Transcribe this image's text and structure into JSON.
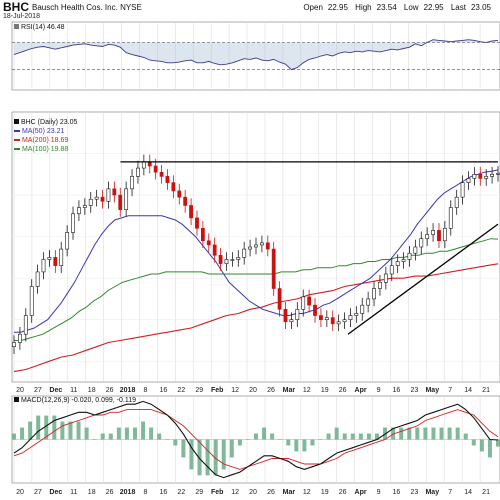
{
  "header": {
    "symbol": "BHC",
    "name": "Bausch Health Cos. Inc.",
    "exchange": "NYSE",
    "date": "18-Jul-2018",
    "open_label": "Open",
    "open": "22.95",
    "high_label": "High",
    "high": "23.54",
    "low_label": "Low",
    "low": "22.95",
    "last_label": "Last",
    "last": "23.05"
  },
  "legends": {
    "rsi": "RSI(14) 46.48",
    "price": "BHC (Daily) 23.05",
    "ma50": "MA(50) 23.21",
    "ma200": "MA(200) 18.69",
    "ma100": "MA(100) 19.88",
    "macd_main": "MACD(12,26,9)",
    "macd_vals": "-0.020, 0.099, -0.119"
  },
  "colors": {
    "ma50": "#3a36b8",
    "ma100": "#2e8a2e",
    "ma200": "#d11f1f",
    "up": "#1a1a1a",
    "down": "#cc1111",
    "trend": "#000000",
    "rsi_fill": "#9fb5cf",
    "macd_line": "#111111",
    "signal_line": "#d22222",
    "hist": "#5fa77f"
  },
  "chart_data": [
    {
      "type": "line",
      "title": "RSI(14) 46.48",
      "x_start": "2017-11-15",
      "y_levels": [
        30,
        70
      ],
      "ylim": [
        0,
        100
      ],
      "series": [
        {
          "name": "RSI(14)",
          "values": [
            52,
            55,
            58,
            61,
            63,
            64,
            62,
            60,
            62,
            64,
            66,
            67,
            68,
            66,
            65,
            64,
            67,
            66,
            63,
            55,
            52,
            50,
            48,
            44,
            43,
            42,
            40,
            40,
            41,
            43,
            44,
            40,
            40,
            42,
            39,
            37,
            38,
            40,
            43,
            46,
            45,
            47,
            44,
            43,
            45,
            41,
            38,
            30,
            33,
            40,
            45,
            47,
            50,
            52,
            50,
            54,
            56,
            55,
            57,
            56,
            58,
            57,
            56,
            58,
            60,
            59,
            61,
            63,
            68,
            65,
            70,
            74,
            73,
            72,
            71,
            72,
            73,
            74,
            73,
            71,
            70,
            72,
            73
          ]
        }
      ]
    },
    {
      "type": "line",
      "title": "BHC (Daily) 23.05",
      "x_start": "2017-11-15",
      "x_end": "2018-07-18",
      "ylim": [
        13,
        26
      ],
      "series": [
        {
          "name": "BHC (Daily)",
          "values": [
            14.9,
            15.3,
            16.2,
            17.6,
            18.3,
            18.9,
            19.0,
            18.6,
            19.4,
            20.2,
            21.1,
            21.4,
            21.5,
            21.8,
            21.9,
            21.7,
            22.3,
            22.0,
            21.3,
            22.3,
            22.9,
            23.3,
            23.6,
            23.4,
            23.1,
            22.9,
            22.6,
            22.2,
            21.9,
            21.5,
            20.9,
            20.4,
            19.8,
            19.6,
            19.1,
            18.7,
            18.9,
            18.9,
            19.0,
            19.4,
            19.5,
            19.6,
            19.7,
            19.4,
            17.5,
            16.5,
            15.9,
            16.0,
            16.5,
            17.1,
            16.7,
            16.2,
            16.0,
            16.1,
            15.8,
            15.9,
            16.0,
            16.2,
            16.3,
            16.7,
            17.0,
            17.5,
            17.8,
            18.2,
            18.6,
            18.8,
            18.9,
            19.2,
            19.5,
            19.9,
            20.1,
            20.3,
            19.8,
            20.4,
            21.4,
            21.9,
            22.6,
            22.8,
            23.0,
            22.8,
            22.9,
            23.0,
            23.05
          ]
        },
        {
          "name": "MA(50)",
          "values": [
            15.4,
            15.4,
            15.5,
            15.6,
            15.8,
            16.0,
            16.4,
            16.8,
            17.3,
            17.8,
            18.4,
            19.0,
            19.6,
            20.1,
            20.5,
            20.8,
            20.9,
            21.0,
            21.0,
            21.0,
            21.0,
            21.0,
            21.0,
            20.9,
            20.8,
            20.6,
            20.3,
            20.0,
            19.6,
            19.2,
            18.8,
            18.3,
            17.8,
            17.5,
            17.2,
            16.9,
            16.7,
            16.5,
            16.4,
            16.3,
            16.2,
            16.2,
            16.3,
            16.3,
            16.4,
            16.5,
            16.7,
            16.8,
            17.0,
            17.2,
            17.4,
            17.6,
            17.8,
            18.0,
            18.3,
            18.6,
            18.9,
            19.3,
            19.7,
            20.1,
            20.6,
            21.0,
            21.4,
            21.8,
            22.1,
            22.3,
            22.5,
            22.7,
            22.9,
            23.0,
            23.1,
            23.15,
            23.21
          ]
        },
        {
          "name": "MA(100)",
          "values": [
            15.0,
            15.0,
            15.1,
            15.2,
            15.3,
            15.5,
            15.7,
            15.9,
            16.1,
            16.4,
            16.6,
            16.9,
            17.1,
            17.4,
            17.6,
            17.8,
            17.9,
            18.0,
            18.1,
            18.2,
            18.2,
            18.3,
            18.3,
            18.3,
            18.3,
            18.3,
            18.3,
            18.2,
            18.2,
            18.2,
            18.2,
            18.2,
            18.2,
            18.2,
            18.2,
            18.2,
            18.2,
            18.3,
            18.3,
            18.3,
            18.4,
            18.4,
            18.5,
            18.5,
            18.5,
            18.6,
            18.6,
            18.7,
            18.7,
            18.8,
            18.8,
            18.9,
            18.9,
            19.0,
            19.0,
            19.1,
            19.1,
            19.2,
            19.2,
            19.3,
            19.3,
            19.4,
            19.5,
            19.6,
            19.7,
            19.8,
            19.9,
            19.88
          ]
        },
        {
          "name": "MA(200)",
          "values": [
            13.5,
            13.6,
            13.8,
            14.0,
            14.2,
            14.3,
            14.5,
            14.7,
            14.9,
            15.0,
            15.1,
            15.2,
            15.3,
            15.4,
            15.5,
            15.6,
            15.8,
            16.0,
            16.2,
            16.3,
            16.5,
            16.6,
            16.8,
            16.9,
            17.0,
            17.2,
            17.3,
            17.4,
            17.6,
            17.7,
            17.8,
            17.9,
            18.0,
            18.0,
            18.1,
            18.1,
            18.2,
            18.3,
            18.4,
            18.5,
            18.6,
            18.69
          ]
        }
      ],
      "annotations": [
        "Resistance line near 23.6",
        "Rising trendline from April lows"
      ]
    },
    {
      "type": "line",
      "title": "MACD(12,26,9) -0.020, 0.099, -0.119",
      "x_start": "2017-11-15",
      "series": [
        {
          "name": "MACD",
          "values": [
            -0.5,
            -0.3,
            0.0,
            0.3,
            0.5,
            0.7,
            0.8,
            0.9,
            1.0,
            1.0,
            0.9,
            1.0,
            1.1,
            1.2,
            1.3,
            1.3,
            1.4,
            1.3,
            1.1,
            0.9,
            0.6,
            0.2,
            -0.3,
            -0.7,
            -1.0,
            -1.3,
            -1.4,
            -1.3,
            -1.2,
            -1.0,
            -0.8,
            -0.6,
            -0.6,
            -0.7,
            -0.8,
            -1.0,
            -1.1,
            -1.0,
            -0.9,
            -0.7,
            -0.5,
            -0.4,
            -0.3,
            -0.2,
            -0.1,
            0.0,
            0.2,
            0.4,
            0.5,
            0.6,
            0.7,
            0.9,
            1.0,
            1.1,
            1.2,
            1.3,
            1.1,
            0.8,
            0.4,
            0.0,
            -0.02
          ]
        },
        {
          "name": "Signal",
          "values": [
            -0.6,
            -0.5,
            -0.3,
            -0.1,
            0.1,
            0.3,
            0.5,
            0.6,
            0.7,
            0.8,
            0.9,
            0.9,
            1.0,
            1.0,
            1.1,
            1.1,
            1.1,
            1.1,
            1.0,
            0.9,
            0.7,
            0.5,
            0.2,
            -0.1,
            -0.4,
            -0.7,
            -0.9,
            -1.0,
            -1.1,
            -1.0,
            -0.9,
            -0.8,
            -0.7,
            -0.7,
            -0.7,
            -0.8,
            -0.9,
            -0.9,
            -0.9,
            -0.8,
            -0.7,
            -0.5,
            -0.4,
            -0.3,
            -0.2,
            -0.1,
            0.0,
            0.2,
            0.3,
            0.4,
            0.5,
            0.7,
            0.8,
            0.9,
            1.0,
            1.1,
            1.0,
            0.9,
            0.6,
            0.3,
            0.099
          ]
        }
      ]
    }
  ],
  "axis": {
    "top_ticks": [
      "20",
      "27",
      "Dec",
      "11",
      "18",
      "26",
      "2018",
      "8",
      "16",
      "22",
      "29",
      "Feb",
      "12",
      "20",
      "26",
      "Mar",
      "12",
      "19",
      "26",
      "Apr",
      "9",
      "16",
      "23",
      "May",
      "7",
      "14",
      "21"
    ],
    "bottom_ticks": [
      "20",
      "27",
      "Dec",
      "11",
      "18",
      "26",
      "2018",
      "8",
      "16",
      "22",
      "29",
      "Feb",
      "12",
      "20",
      "26",
      "Mar",
      "12",
      "19",
      "26",
      "Apr",
      "9",
      "16",
      "23",
      "May",
      "7",
      "14",
      "21"
    ]
  }
}
